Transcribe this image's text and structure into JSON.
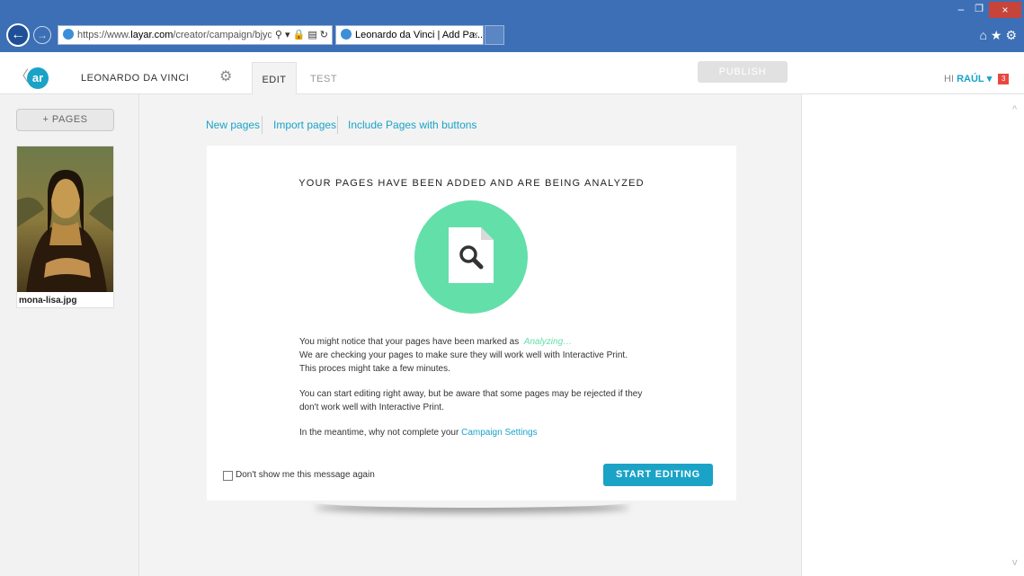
{
  "browser": {
    "url_scheme": "https://www.",
    "url_domain": "layar.com",
    "url_path": "/creator/campaign/bjyqc",
    "tab_title": "Leonardo da Vinci | Add Pa...",
    "tab_close": "×",
    "back_glyph": "←",
    "forward_glyph": "→",
    "address_icons": "⚲ ▾ 🔒 ▤ ↻",
    "min_glyph": "–",
    "max_glyph": "❐",
    "close_glyph": "×",
    "tools_glyphs": "⌂★⚙"
  },
  "header": {
    "back_glyph": "〈",
    "logo_text": "ar",
    "campaign_name": "LEONARDO DA VINCI",
    "gear_glyph": "⚙",
    "tab_edit": "EDIT",
    "tab_test": "TEST",
    "publish_label": "PUBLISH",
    "greeting": "HI",
    "user_name": "RAÚL",
    "caret": "▾",
    "notification_count": "3"
  },
  "sidebar": {
    "add_pages_label": "+ PAGES",
    "pages": [
      {
        "name": "mona-lisa.jpg"
      }
    ]
  },
  "main": {
    "links": {
      "new_pages": "New pages",
      "import_pages": "Import pages",
      "include_pages": "Include Pages with buttons"
    },
    "card": {
      "title": "YOUR PAGES HAVE BEEN ADDED AND ARE BEING ANALYZED",
      "line1_prefix": "You might notice that your pages have been marked as",
      "line1_status": "Analyzing…",
      "line2": "We are checking your pages to make sure they will work well with Interactive Print.",
      "line3": "This proces might take a few minutes.",
      "line4": "You can start editing right away, but be aware that some pages may be rejected if they",
      "line5": "don't work well with Interactive Print.",
      "line6_prefix": "In the meantime, why not complete your",
      "line6_link": "Campaign Settings",
      "dont_show_label": "Don't show me this message again",
      "start_label": "START EDITING"
    }
  },
  "colors": {
    "accent": "#1aa3c7",
    "analyzing_green": "#63dfaa",
    "browser_blue": "#3c6fb5"
  },
  "scroll": {
    "up_glyph": "^",
    "down_glyph": "v"
  }
}
